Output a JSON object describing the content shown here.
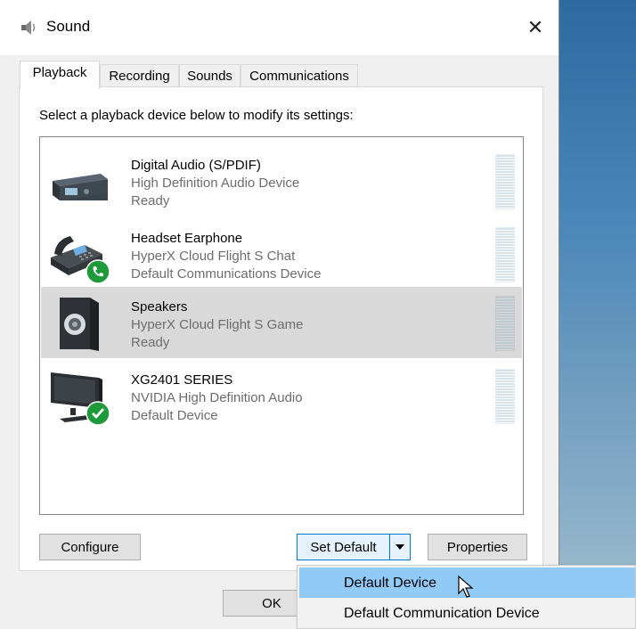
{
  "window": {
    "title": "Sound",
    "close_glyph": "✕"
  },
  "tabs": [
    {
      "label": "Playback",
      "active": true
    },
    {
      "label": "Recording",
      "active": false
    },
    {
      "label": "Sounds",
      "active": false
    },
    {
      "label": "Communications",
      "active": false
    }
  ],
  "instructions": "Select a playback device below to modify its settings:",
  "devices": [
    {
      "name": "Digital Audio (S/PDIF)",
      "description": "High Definition Audio Device",
      "status": "Ready",
      "icon": "digital-audio-receiver-icon",
      "selected": false
    },
    {
      "name": "Headset Earphone",
      "description": "HyperX Cloud Flight S Chat",
      "status": "Default Communications Device",
      "icon": "telephone-icon",
      "badge": "phone-badge-icon",
      "selected": false
    },
    {
      "name": "Speakers",
      "description": "HyperX Cloud Flight S Game",
      "status": "Ready",
      "icon": "speaker-icon",
      "selected": true
    },
    {
      "name": "XG2401 SERIES",
      "description": "NVIDIA High Definition Audio",
      "status": "Default Device",
      "icon": "monitor-icon",
      "badge": "checkmark-badge-icon",
      "selected": false
    }
  ],
  "buttons": {
    "configure": "Configure",
    "set_default": "Set Default",
    "properties": "Properties",
    "ok": "OK"
  },
  "dropdown_menu": [
    {
      "label": "Default Device",
      "hovered": true
    },
    {
      "label": "Default Communication Device",
      "hovered": false
    }
  ],
  "colors": {
    "selection": "#d9d9d9",
    "menu_hover": "#91c9f7",
    "focus_border": "#0078d7",
    "badge_green": "#1f9a3a"
  }
}
